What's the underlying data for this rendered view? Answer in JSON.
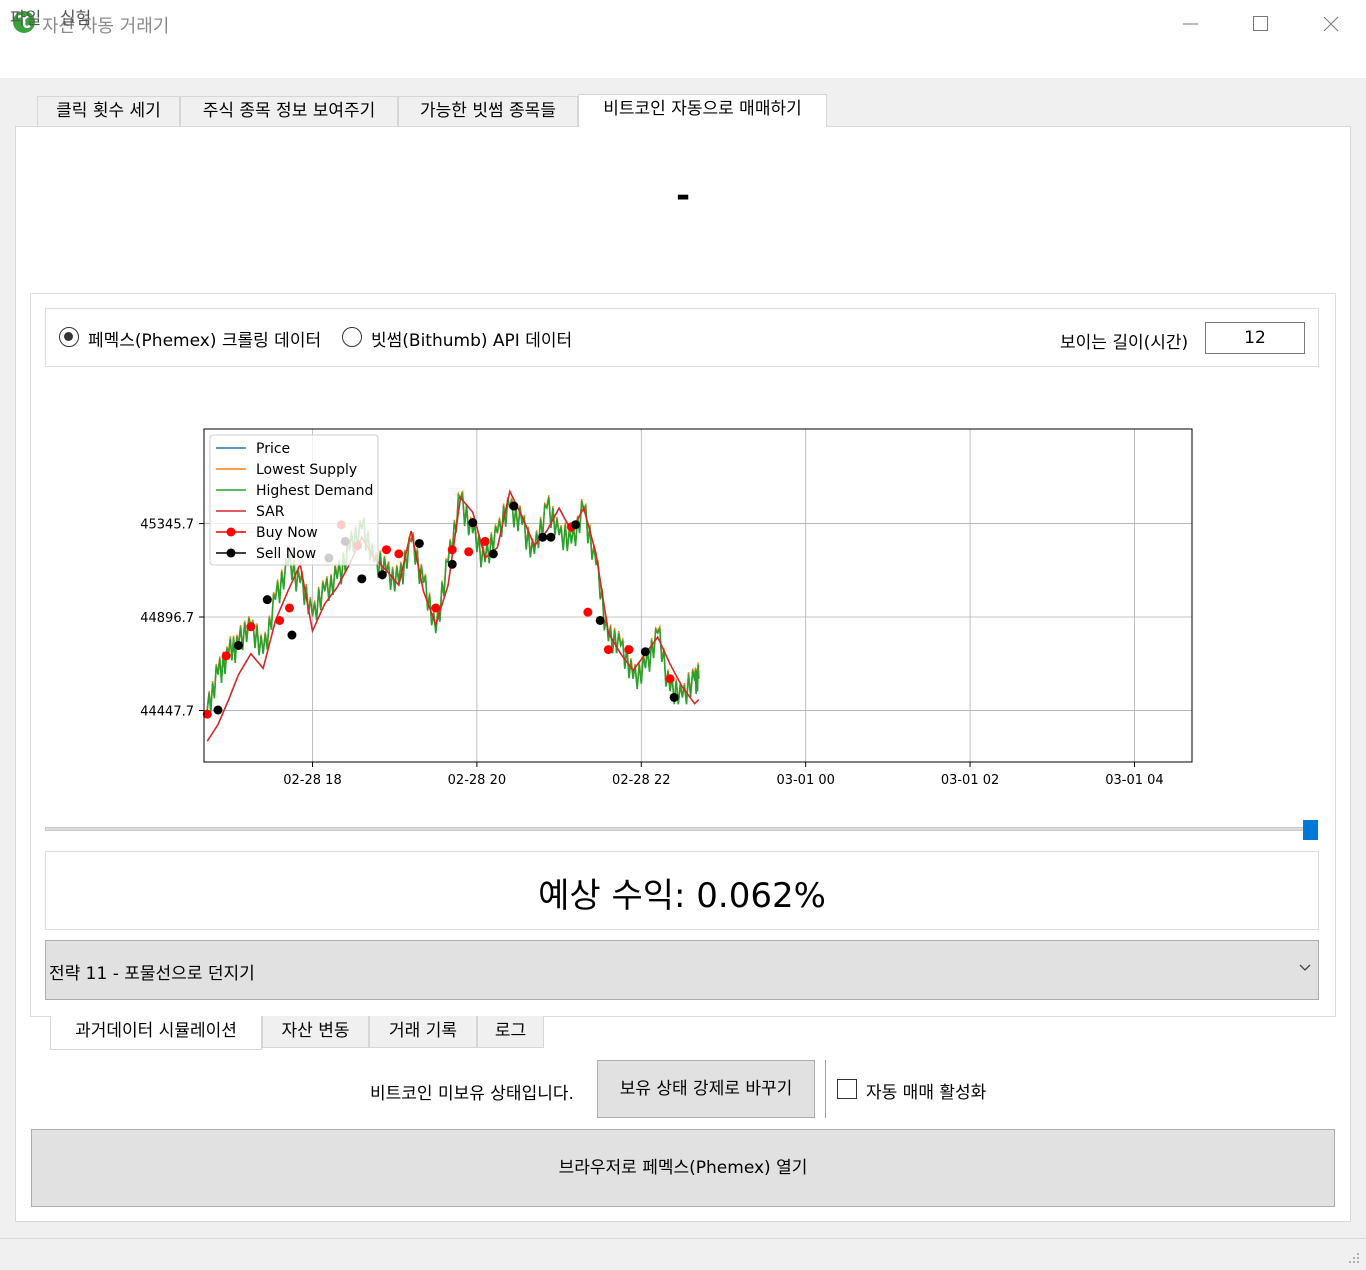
{
  "window": {
    "title": "자산 자동 거래기"
  },
  "menu": {
    "file": "파일",
    "experiment": "실험"
  },
  "top_tabs": [
    {
      "label": "클릭 횟수 세기",
      "active": false
    },
    {
      "label": "주식 종목 정보 보여주기",
      "active": false
    },
    {
      "label": "가능한 빗썸 종목들",
      "active": false
    },
    {
      "label": "비트코인 자동으로 매매하기",
      "active": true
    }
  ],
  "header": {
    "big_text": "-"
  },
  "source": {
    "phemex_label": "페멕스(Phemex) 크롤링 데이터",
    "phemex_checked": true,
    "bithumb_label": "빗썸(Bithumb) API 데이터",
    "bithumb_checked": false,
    "visible_length_label": "보이는 길이(시간)",
    "visible_length_value": "12"
  },
  "chart_data": {
    "type": "line",
    "title": "",
    "xlabel": "",
    "ylabel": "",
    "x_tick_labels": [
      "02-28 18",
      "02-28 20",
      "02-28 22",
      "03-01 00",
      "03-01 02",
      "03-01 04"
    ],
    "x_tick_hours": [
      18,
      20,
      22,
      24,
      26,
      28
    ],
    "xlim_hours": [
      16.68,
      28.7
    ],
    "y_tick_labels": [
      "45345.7",
      "44896.7",
      "44447.7"
    ],
    "y_ticks": [
      45345.7,
      44896.7,
      44447.7
    ],
    "ylim": [
      44200,
      45800
    ],
    "grid": true,
    "legend": {
      "placement": "upper-left",
      "entries": [
        "Price",
        "Lowest Supply",
        "Highest Demand",
        "SAR",
        "Buy Now",
        "Sell Now"
      ]
    },
    "colors": {
      "Price": "#1f77b4",
      "Lowest Supply": "#ff7f0e",
      "Highest Demand": "#2ca02c",
      "SAR": "#d62728",
      "Buy Now": "#ff0000",
      "Sell Now": "#000000"
    },
    "series": [
      {
        "name": "Highest Demand",
        "hours": [
          16.72,
          16.85,
          16.98,
          17.1,
          17.25,
          17.4,
          17.55,
          17.7,
          17.85,
          18.0,
          18.15,
          18.3,
          18.45,
          18.6,
          18.75,
          18.9,
          19.05,
          19.2,
          19.35,
          19.5,
          19.65,
          19.8,
          19.95,
          20.1,
          20.25,
          20.4,
          20.55,
          20.7,
          20.85,
          21.0,
          21.15,
          21.3,
          21.45,
          21.6,
          21.75,
          21.9,
          22.05,
          22.2,
          22.35,
          22.5,
          22.65,
          22.7
        ],
        "values": [
          44450,
          44620,
          44720,
          44760,
          44850,
          44720,
          44980,
          45150,
          45060,
          44900,
          45020,
          45080,
          45220,
          45320,
          45160,
          45110,
          45060,
          45260,
          45060,
          44820,
          45160,
          45460,
          45300,
          45160,
          45300,
          45420,
          45340,
          45200,
          45420,
          45290,
          45250,
          45410,
          45150,
          44780,
          44760,
          44600,
          44650,
          44820,
          44540,
          44510,
          44590,
          44600
        ]
      },
      {
        "name": "SAR",
        "hours": [
          16.72,
          16.85,
          16.98,
          17.1,
          17.25,
          17.4,
          17.55,
          17.7,
          17.85,
          18.0,
          18.15,
          18.3,
          18.45,
          18.6,
          18.75,
          18.9,
          19.05,
          19.2,
          19.35,
          19.5,
          19.65,
          19.8,
          19.95,
          20.1,
          20.25,
          20.4,
          20.55,
          20.7,
          20.85,
          21.0,
          21.15,
          21.3,
          21.45,
          21.6,
          21.75,
          21.9,
          22.05,
          22.2,
          22.35,
          22.5,
          22.65,
          22.7
        ],
        "values": [
          44300,
          44380,
          44500,
          44620,
          44720,
          44650,
          44880,
          45020,
          45150,
          44830,
          44960,
          45040,
          45150,
          45280,
          45180,
          45120,
          45050,
          45310,
          45020,
          44860,
          45050,
          45470,
          45400,
          45180,
          45230,
          45500,
          45380,
          45240,
          45310,
          45420,
          45310,
          45420,
          45200,
          44820,
          44720,
          44640,
          44720,
          44800,
          44670,
          44560,
          44480,
          44500
        ]
      }
    ],
    "markers": {
      "Buy Now": {
        "hours": [
          16.72,
          16.95,
          17.25,
          17.6,
          17.72,
          18.35,
          18.55,
          18.9,
          19.05,
          19.5,
          19.7,
          19.9,
          20.1,
          21.15,
          21.35,
          21.6,
          21.85,
          22.35
        ],
        "values": [
          44430,
          44710,
          44850,
          44880,
          44940,
          45340,
          45240,
          45220,
          45200,
          44940,
          45220,
          45210,
          45260,
          45330,
          44920,
          44740,
          44740,
          44600
        ]
      },
      "Sell Now": {
        "hours": [
          16.85,
          17.1,
          17.45,
          17.75,
          18.2,
          18.4,
          18.6,
          18.85,
          19.3,
          19.7,
          19.95,
          20.2,
          20.45,
          20.8,
          20.9,
          21.2,
          21.5,
          22.05,
          22.4
        ],
        "values": [
          44450,
          44760,
          44980,
          44810,
          45180,
          45260,
          45080,
          45100,
          45250,
          45150,
          45350,
          45200,
          45430,
          45280,
          45280,
          45340,
          44880,
          44730,
          44510
        ]
      }
    }
  },
  "profit": {
    "text": "예상 수익: 0.062%"
  },
  "strategy": {
    "selected": "전략 11 - 포물선으로 던지기"
  },
  "bottom_tabs": [
    {
      "label": "과거데이터 시뮬레이션",
      "active": true
    },
    {
      "label": "자산 변동",
      "active": false
    },
    {
      "label": "거래 기록",
      "active": false
    },
    {
      "label": "로그",
      "active": false
    }
  ],
  "controls": {
    "holding_status": "비트코인 미보유 상태입니다.",
    "force_button": "보유 상태 강제로 바꾸기",
    "auto_trade_label": "자동 매매 활성화",
    "auto_trade_checked": false,
    "open_browser_button": "브라우저로 페멕스(Phemex) 열기"
  }
}
